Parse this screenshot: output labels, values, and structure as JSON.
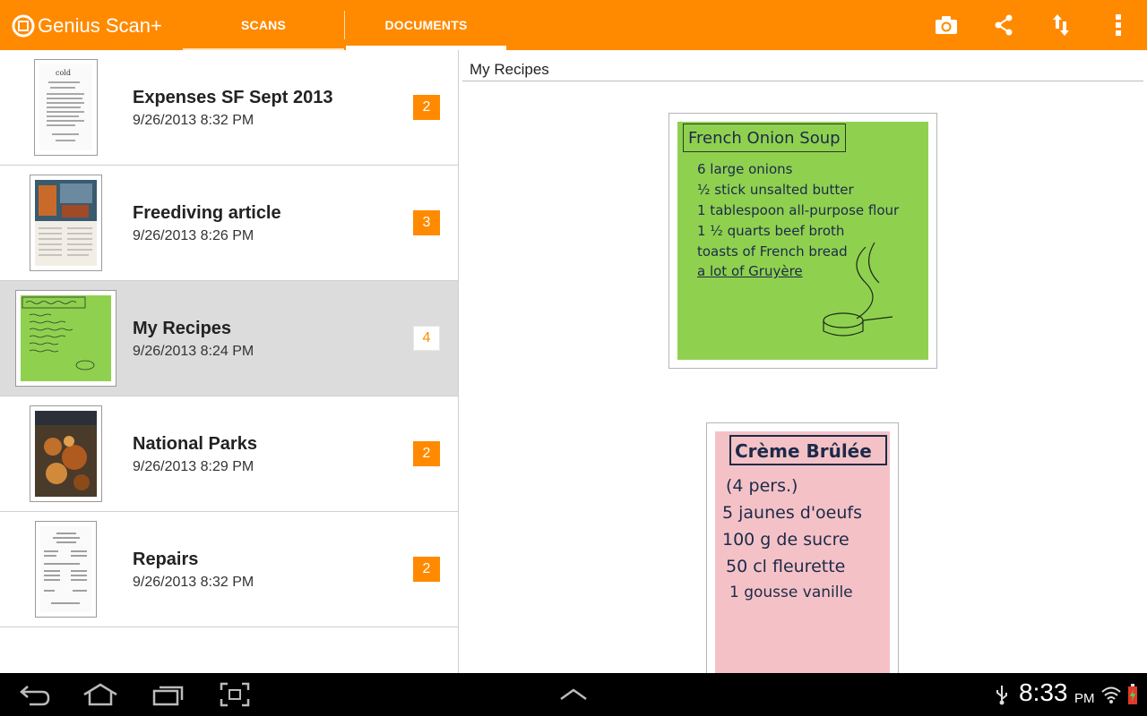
{
  "app": {
    "title": "Genius Scan+"
  },
  "tabs": [
    {
      "label": "SCANS",
      "selected": false
    },
    {
      "label": "DOCUMENTS",
      "selected": true
    }
  ],
  "toolbar_icons": [
    "camera-icon",
    "share-icon",
    "sort-icon",
    "overflow-menu-icon"
  ],
  "documents": [
    {
      "title": "Expenses SF Sept 2013",
      "date": "9/26/2013 8:32 PM",
      "pages": "2"
    },
    {
      "title": "Freediving article",
      "date": "9/26/2013 8:26 PM",
      "pages": "3"
    },
    {
      "title": "My Recipes",
      "date": "9/26/2013 8:24 PM",
      "pages": "4",
      "selected": true
    },
    {
      "title": "National Parks",
      "date": "9/26/2013 8:29 PM",
      "pages": "2"
    },
    {
      "title": "Repairs",
      "date": "9/26/2013 8:32 PM",
      "pages": "2"
    }
  ],
  "detail": {
    "title": "My Recipes",
    "pages": [
      {
        "heading": "French Onion Soup",
        "lines": [
          "6 large onions",
          "½ stick unsalted butter",
          "1 tablespoon all-purpose flour",
          "1 ½ quarts beef broth",
          "toasts of French bread",
          "a lot of Gruyère"
        ]
      },
      {
        "heading": "Crème Brûlée",
        "lines": [
          "(4 pers.)",
          "5 jaunes d'oeufs",
          "100 g de sucre",
          "50 cl fleurette",
          "1 gousse vanille"
        ]
      }
    ]
  },
  "status": {
    "time": "8:33",
    "ampm": "PM"
  },
  "colors": {
    "accent": "#ff8a00",
    "selected_row": "#dcdcdc",
    "recipe_green": "#8fd14f",
    "recipe_pink": "#f4c2c6"
  }
}
